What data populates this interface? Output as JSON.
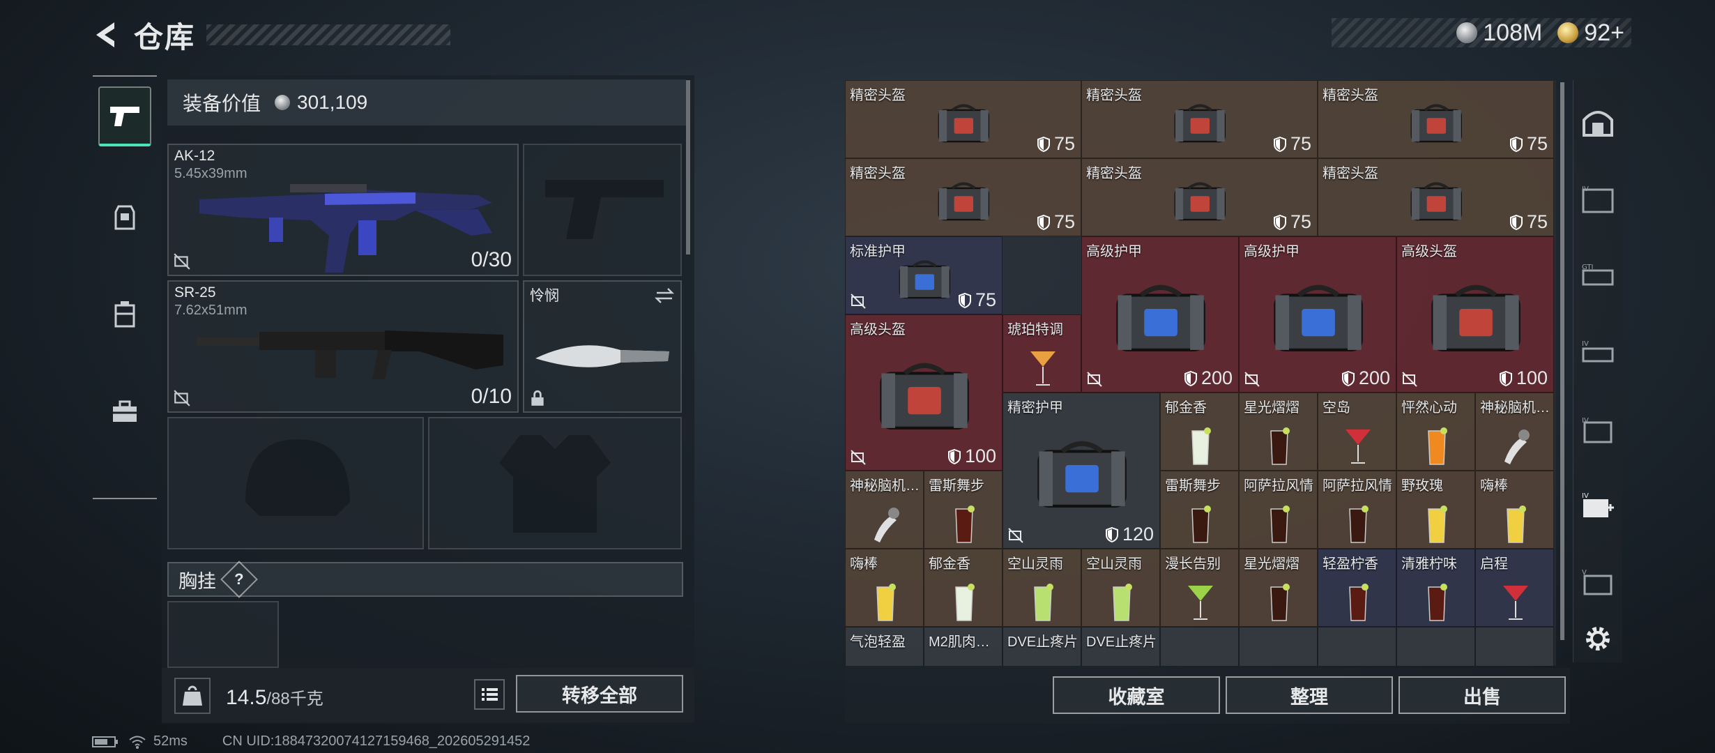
{
  "header": {
    "title": "仓库"
  },
  "currency": [
    {
      "icon": "silver-coin-icon",
      "value": "108M"
    },
    {
      "icon": "gold-coin-icon",
      "value": "92+"
    }
  ],
  "equipment": {
    "value_label": "装备价值",
    "value": "301,109",
    "primary": {
      "name": "AK-12",
      "caliber": "5.45x39mm",
      "ammo": "0/30"
    },
    "secondary": {
      "name": "SR-25",
      "caliber": "7.62x51mm",
      "ammo": "0/10"
    },
    "melee": {
      "name": "怜悯"
    },
    "chest_rig_label": "胸挂",
    "chest_rig_help": "?"
  },
  "bottom_left": {
    "weight": "14.5",
    "capacity": "/88千克",
    "transfer_label": "转移全部"
  },
  "storage": {
    "cells": [
      {
        "name": "精密头盔",
        "val": "75",
        "color": "brown",
        "kind": "bag",
        "bag": "red"
      },
      {
        "name": "精密头盔",
        "val": "75",
        "color": "brown",
        "kind": "bag",
        "bag": "red"
      },
      {
        "name": "精密头盔",
        "val": "75",
        "color": "brown",
        "kind": "bag",
        "bag": "red"
      },
      {
        "name": "精密头盔",
        "val": "75",
        "color": "brown",
        "kind": "bag",
        "bag": "red"
      },
      {
        "name": "精密头盔",
        "val": "75",
        "color": "brown",
        "kind": "bag",
        "bag": "red"
      },
      {
        "name": "精密头盔",
        "val": "75",
        "color": "brown",
        "kind": "bag",
        "bag": "red"
      },
      {
        "name": "标准护甲",
        "val": "75",
        "color": "navy",
        "kind": "bag",
        "bag": "blue"
      },
      {
        "name": "高级护甲",
        "val": "200",
        "color": "red",
        "kind": "bag",
        "bag": "blue"
      },
      {
        "name": "高级护甲",
        "val": "200",
        "color": "red",
        "kind": "bag",
        "bag": "blue"
      },
      {
        "name": "高级头盔",
        "val": "100",
        "color": "red",
        "kind": "bag",
        "bag": "red"
      },
      {
        "name": "高级头盔",
        "val": "100",
        "color": "red",
        "kind": "bag",
        "bag": "red"
      },
      {
        "name": "琥珀特调",
        "val": "",
        "color": "red",
        "kind": "drink",
        "drink": "martini"
      },
      {
        "name": "精密护甲",
        "val": "120",
        "color": "grey",
        "kind": "bag",
        "bag": "blue"
      },
      {
        "name": "郁金香",
        "val": "",
        "color": "brown",
        "kind": "drink",
        "drink": "highball"
      },
      {
        "name": "星光熠熠",
        "val": "",
        "color": "brown",
        "kind": "drink",
        "drink": "cola"
      },
      {
        "name": "空岛",
        "val": "",
        "color": "brown",
        "kind": "drink",
        "drink": "cocktail"
      },
      {
        "name": "怦然心动",
        "val": "",
        "color": "brown",
        "kind": "drink",
        "drink": "orange"
      },
      {
        "name": "神秘脑机…",
        "val": "",
        "color": "brown",
        "kind": "drink",
        "drink": "chip"
      },
      {
        "name": "神秘脑机…",
        "val": "",
        "color": "brown",
        "kind": "drink",
        "drink": "chip"
      },
      {
        "name": "雷斯舞步",
        "val": "",
        "color": "brown",
        "kind": "drink",
        "drink": "rocks"
      },
      {
        "name": "雷斯舞步",
        "val": "",
        "color": "brown",
        "kind": "drink",
        "drink": "cola"
      },
      {
        "name": "阿萨拉风情",
        "val": "",
        "color": "brown",
        "kind": "drink",
        "drink": "cola"
      },
      {
        "name": "阿萨拉风情",
        "val": "",
        "color": "brown",
        "kind": "drink",
        "drink": "cola"
      },
      {
        "name": "野玫瑰",
        "val": "",
        "color": "brown",
        "kind": "drink",
        "drink": "yellow"
      },
      {
        "name": "嗨棒",
        "val": "",
        "color": "brown",
        "kind": "drink",
        "drink": "yellow"
      },
      {
        "name": "嗨棒",
        "val": "",
        "color": "brown",
        "kind": "drink",
        "drink": "yellow"
      },
      {
        "name": "郁金香",
        "val": "",
        "color": "brown",
        "kind": "drink",
        "drink": "highball"
      },
      {
        "name": "空山灵雨",
        "val": "",
        "color": "brown",
        "kind": "drink",
        "drink": "green"
      },
      {
        "name": "空山灵雨",
        "val": "",
        "color": "brown",
        "kind": "drink",
        "drink": "green"
      },
      {
        "name": "漫长告别",
        "val": "",
        "color": "brown",
        "kind": "drink",
        "drink": "martini-green"
      },
      {
        "name": "星光熠熠",
        "val": "",
        "color": "brown",
        "kind": "drink",
        "drink": "cola"
      },
      {
        "name": "轻盈柠香",
        "val": "",
        "color": "navy",
        "kind": "drink",
        "drink": "rocks"
      },
      {
        "name": "清雅柠味",
        "val": "",
        "color": "navy",
        "kind": "drink",
        "drink": "rocks"
      },
      {
        "name": "启程",
        "val": "",
        "color": "navy",
        "kind": "drink",
        "drink": "cocktail"
      },
      {
        "name": "气泡轻盈",
        "val": "",
        "color": "grey",
        "kind": "drink",
        "drink": "none"
      },
      {
        "name": "M2肌肉…",
        "val": "",
        "color": "grey",
        "kind": "drink",
        "drink": "none"
      },
      {
        "name": "DVE止疼片",
        "val": "",
        "color": "grey",
        "kind": "drink",
        "drink": "none"
      },
      {
        "name": "DVE止疼片",
        "val": "",
        "color": "grey",
        "kind": "drink",
        "drink": "none"
      }
    ]
  },
  "bottom_buttons": {
    "collection": "收藏室",
    "sort": "整理",
    "sell": "出售"
  },
  "status": {
    "ping": "52ms",
    "uid": "CN UID:18847320074127159468_202605291452"
  }
}
